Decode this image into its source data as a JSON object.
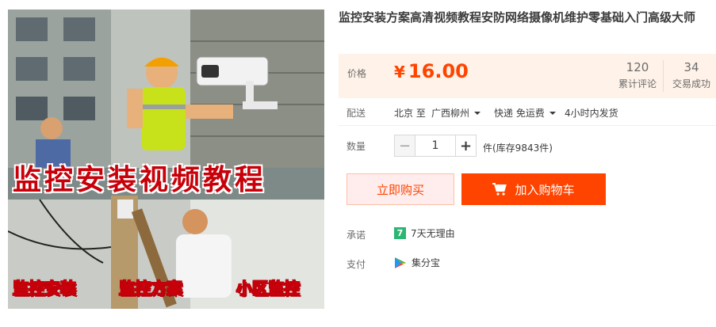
{
  "product": {
    "title": "监控安装方案高清视频教程安防网络摄像机维护零基础入门高级大师",
    "image_overlay": {
      "headline": "监控安装视频教程",
      "keywords_row1": [
        "监控安装",
        "监控方案",
        "小区监控"
      ]
    }
  },
  "price": {
    "label": "价格",
    "currency": "¥",
    "value": "16.00",
    "stats": [
      {
        "count": "120",
        "caption": "累计评论"
      },
      {
        "count": "34",
        "caption": "交易成功"
      }
    ]
  },
  "shipping": {
    "label": "配送",
    "from": "北京 至",
    "to": "广西柳州",
    "method": "快递 免运费",
    "dispatch": "4小时内发货"
  },
  "quantity": {
    "label": "数量",
    "value": "1",
    "minus": "−",
    "plus": "+",
    "stock_text": "件(库存9843件)"
  },
  "actions": {
    "buy_now": "立即购买",
    "add_to_cart": "加入购物车"
  },
  "promise": {
    "label": "承诺",
    "badge": "7",
    "text": "7天无理由"
  },
  "payment": {
    "label": "支付",
    "text": "集分宝"
  },
  "colors": {
    "accent": "#ff4400",
    "price_bg": "#fff2e8",
    "promise_green": "#2cb673"
  }
}
